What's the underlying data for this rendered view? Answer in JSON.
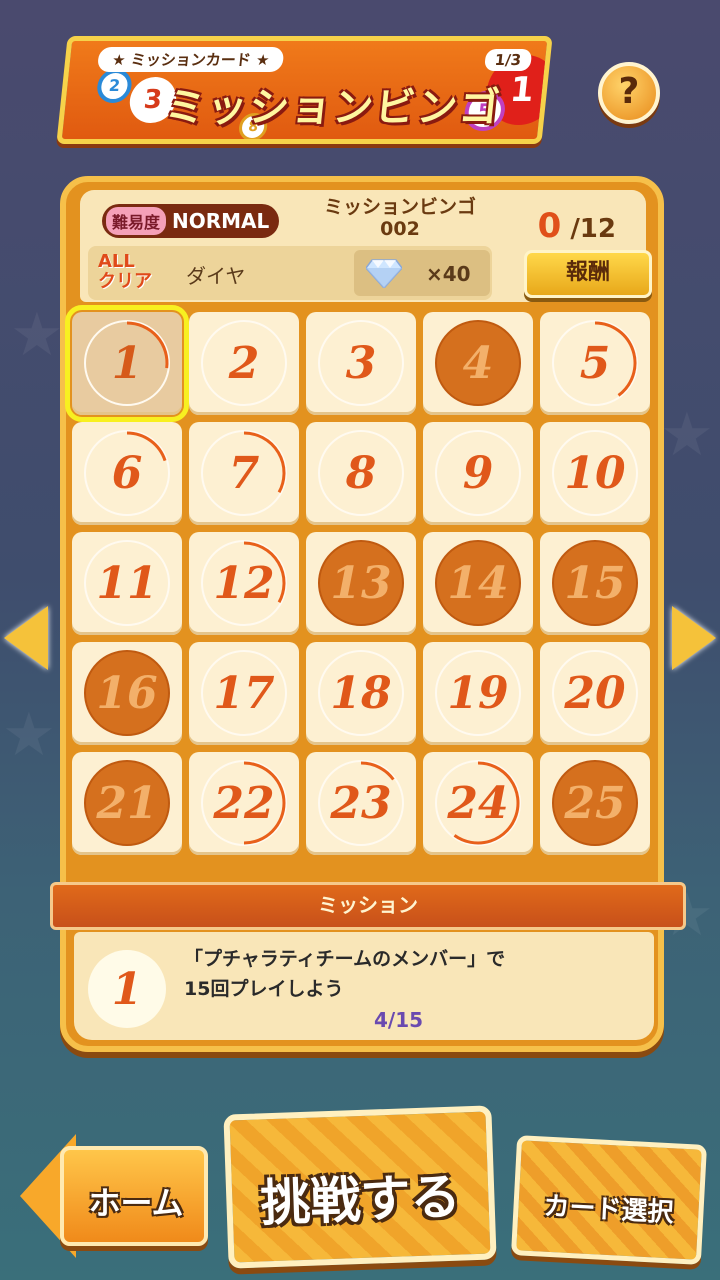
{
  "header": {
    "subtitle": "★ ミッションカード ★",
    "title": "ミッションビンゴ",
    "page": "1/3",
    "balls": [
      "1",
      "2",
      "3",
      "5",
      "8"
    ]
  },
  "help_label": "?",
  "bingo": {
    "difficulty_label": "難易度",
    "difficulty_value": "NORMAL",
    "name": "ミッションビンゴ\n002",
    "cleared": "0",
    "total": "/12",
    "all_clear_label": "ALL\nクリア",
    "reward_name": "ダイヤ",
    "reward_count": "×40",
    "reward_button": "報酬"
  },
  "cells": [
    {
      "n": "1",
      "state": "selected",
      "progress": 0.27
    },
    {
      "n": "2",
      "state": "open",
      "progress": 0
    },
    {
      "n": "3",
      "state": "open",
      "progress": 0
    },
    {
      "n": "4",
      "state": "cleared",
      "progress": 1
    },
    {
      "n": "5",
      "state": "open",
      "progress": 0.4
    },
    {
      "n": "6",
      "state": "open",
      "progress": 0.2
    },
    {
      "n": "7",
      "state": "open",
      "progress": 0.33
    },
    {
      "n": "8",
      "state": "open",
      "progress": 0
    },
    {
      "n": "9",
      "state": "open",
      "progress": 0
    },
    {
      "n": "10",
      "state": "open",
      "progress": 0
    },
    {
      "n": "11",
      "state": "open",
      "progress": 0
    },
    {
      "n": "12",
      "state": "open",
      "progress": 0.33
    },
    {
      "n": "13",
      "state": "cleared",
      "progress": 1
    },
    {
      "n": "14",
      "state": "cleared",
      "progress": 1
    },
    {
      "n": "15",
      "state": "cleared",
      "progress": 1
    },
    {
      "n": "16",
      "state": "cleared",
      "progress": 1
    },
    {
      "n": "17",
      "state": "open",
      "progress": 0
    },
    {
      "n": "18",
      "state": "open",
      "progress": 0
    },
    {
      "n": "19",
      "state": "open",
      "progress": 0
    },
    {
      "n": "20",
      "state": "open",
      "progress": 0
    },
    {
      "n": "21",
      "state": "cleared",
      "progress": 1
    },
    {
      "n": "22",
      "state": "open",
      "progress": 0.5
    },
    {
      "n": "23",
      "state": "open",
      "progress": 0.15
    },
    {
      "n": "24",
      "state": "open",
      "progress": 0.6
    },
    {
      "n": "25",
      "state": "cleared",
      "progress": 1
    }
  ],
  "mission": {
    "header": "ミッション",
    "number": "1",
    "text": "「プチャラティチームのメンバー」で\n15回プレイしよう",
    "progress": "4/15"
  },
  "buttons": {
    "home": "ホーム",
    "challenge": "挑戦する",
    "card_select": "カード選択"
  },
  "colors": {
    "accent": "#e0581a",
    "cleared_circle": "#d5701e",
    "progress_arc": "#e8601a",
    "selection": "#f8f020"
  }
}
